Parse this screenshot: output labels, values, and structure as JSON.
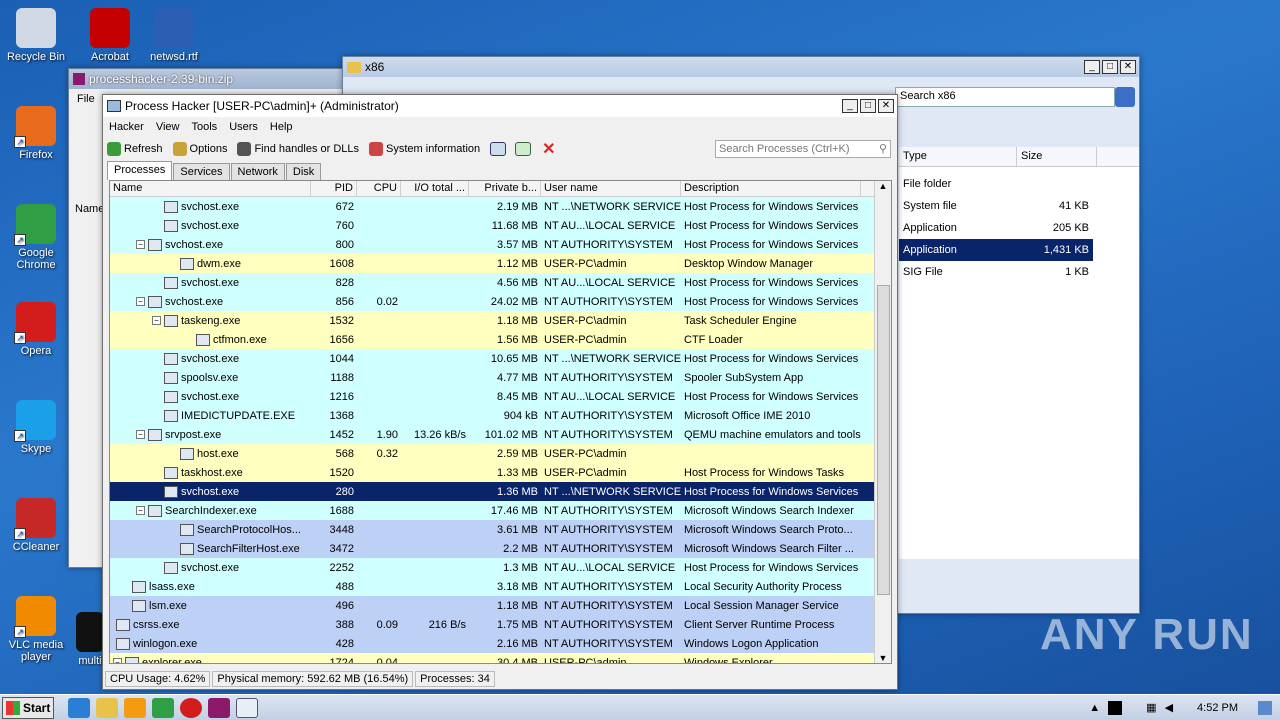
{
  "desktop": {
    "icons": [
      {
        "label": "Recycle Bin",
        "icon": "recycle-bin-icon",
        "color": "#cfd8e3"
      },
      {
        "label": "Firefox",
        "icon": "firefox-icon",
        "color": "#e86a1c"
      },
      {
        "label": "Google Chrome",
        "icon": "chrome-icon",
        "color": "#2f9e44"
      },
      {
        "label": "Opera",
        "icon": "opera-icon",
        "color": "#d31c1c"
      },
      {
        "label": "Skype",
        "icon": "skype-icon",
        "color": "#1aa0e8"
      },
      {
        "label": "CCleaner",
        "icon": "ccleaner-icon",
        "color": "#c62828"
      },
      {
        "label": "VLC media player",
        "icon": "vlc-icon",
        "color": "#f08a00"
      }
    ],
    "col2": [
      {
        "label": "Acrobat",
        "icon": "acrobat-icon",
        "color": "#c40000"
      },
      {
        "label": "netwsd.rtf",
        "icon": "word-doc-icon",
        "color": "#2b5fb4"
      }
    ],
    "multi_label": "multi"
  },
  "explorer": {
    "title": "x86",
    "search_placeholder": "Search x86",
    "col_type": "Type",
    "col_size": "Size",
    "rows": [
      {
        "type": "File folder",
        "size": ""
      },
      {
        "type": "System file",
        "size": "41 KB"
      },
      {
        "type": "Application",
        "size": "205 KB"
      },
      {
        "type": "Application",
        "size": "1,431 KB"
      },
      {
        "type": "SIG File",
        "size": "1 KB"
      }
    ]
  },
  "zipwin": {
    "title": "processhacker-2.39-bin.zip",
    "menu_file": "File",
    "col_name": "Name"
  },
  "ph": {
    "title": "Process Hacker [USER-PC\\admin]+ (Administrator)",
    "menu": [
      "Hacker",
      "View",
      "Tools",
      "Users",
      "Help"
    ],
    "toolbar": {
      "refresh": "Refresh",
      "options": "Options",
      "find": "Find handles or DLLs",
      "sysinfo": "System information"
    },
    "search_placeholder": "Search Processes (Ctrl+K)",
    "tabs": [
      "Processes",
      "Services",
      "Network",
      "Disk"
    ],
    "columns": [
      "Name",
      "PID",
      "CPU",
      "I/O total ...",
      "Private b...",
      "User name",
      "Description"
    ],
    "rows": [
      {
        "indent": 3,
        "tog": "",
        "name": "svchost.exe",
        "pid": "672",
        "cpu": "",
        "io": "",
        "priv": "2.19 MB",
        "user": "NT ...\\NETWORK SERVICE",
        "desc": "Host Process for Windows Services",
        "bg": "cyan"
      },
      {
        "indent": 3,
        "tog": "",
        "name": "svchost.exe",
        "pid": "760",
        "cpu": "",
        "io": "",
        "priv": "11.68 MB",
        "user": "NT AU...\\LOCAL SERVICE",
        "desc": "Host Process for Windows Services",
        "bg": "cyan"
      },
      {
        "indent": 2,
        "tog": "−",
        "name": "svchost.exe",
        "pid": "800",
        "cpu": "",
        "io": "",
        "priv": "3.57 MB",
        "user": "NT AUTHORITY\\SYSTEM",
        "desc": "Host Process for Windows Services",
        "bg": "cyan"
      },
      {
        "indent": 4,
        "tog": "",
        "name": "dwm.exe",
        "pid": "1608",
        "cpu": "",
        "io": "",
        "priv": "1.12 MB",
        "user": "USER-PC\\admin",
        "desc": "Desktop Window Manager",
        "bg": "yellow"
      },
      {
        "indent": 3,
        "tog": "",
        "name": "svchost.exe",
        "pid": "828",
        "cpu": "",
        "io": "",
        "priv": "4.56 MB",
        "user": "NT AU...\\LOCAL SERVICE",
        "desc": "Host Process for Windows Services",
        "bg": "cyan"
      },
      {
        "indent": 2,
        "tog": "−",
        "name": "svchost.exe",
        "pid": "856",
        "cpu": "0.02",
        "io": "",
        "priv": "24.02 MB",
        "user": "NT AUTHORITY\\SYSTEM",
        "desc": "Host Process for Windows Services",
        "bg": "cyan"
      },
      {
        "indent": 3,
        "tog": "−",
        "name": "taskeng.exe",
        "pid": "1532",
        "cpu": "",
        "io": "",
        "priv": "1.18 MB",
        "user": "USER-PC\\admin",
        "desc": "Task Scheduler Engine",
        "bg": "yellow"
      },
      {
        "indent": 5,
        "tog": "",
        "name": "ctfmon.exe",
        "pid": "1656",
        "cpu": "",
        "io": "",
        "priv": "1.56 MB",
        "user": "USER-PC\\admin",
        "desc": "CTF Loader",
        "bg": "yellow"
      },
      {
        "indent": 3,
        "tog": "",
        "name": "svchost.exe",
        "pid": "1044",
        "cpu": "",
        "io": "",
        "priv": "10.65 MB",
        "user": "NT ...\\NETWORK SERVICE",
        "desc": "Host Process for Windows Services",
        "bg": "cyan"
      },
      {
        "indent": 3,
        "tog": "",
        "name": "spoolsv.exe",
        "pid": "1188",
        "cpu": "",
        "io": "",
        "priv": "4.77 MB",
        "user": "NT AUTHORITY\\SYSTEM",
        "desc": "Spooler SubSystem App",
        "bg": "cyan"
      },
      {
        "indent": 3,
        "tog": "",
        "name": "svchost.exe",
        "pid": "1216",
        "cpu": "",
        "io": "",
        "priv": "8.45 MB",
        "user": "NT AU...\\LOCAL SERVICE",
        "desc": "Host Process for Windows Services",
        "bg": "cyan"
      },
      {
        "indent": 3,
        "tog": "",
        "name": "IMEDICTUPDATE.EXE",
        "pid": "1368",
        "cpu": "",
        "io": "",
        "priv": "904 kB",
        "user": "NT AUTHORITY\\SYSTEM",
        "desc": "Microsoft Office IME 2010",
        "bg": "cyan"
      },
      {
        "indent": 2,
        "tog": "−",
        "name": "srvpost.exe",
        "pid": "1452",
        "cpu": "1.90",
        "io": "13.26 kB/s",
        "priv": "101.02 MB",
        "user": "NT AUTHORITY\\SYSTEM",
        "desc": "QEMU machine emulators and tools",
        "bg": "cyan"
      },
      {
        "indent": 4,
        "tog": "",
        "name": "host.exe",
        "pid": "568",
        "cpu": "0.32",
        "io": "",
        "priv": "2.59 MB",
        "user": "USER-PC\\admin",
        "desc": "",
        "bg": "yellow"
      },
      {
        "indent": 3,
        "tog": "",
        "name": "taskhost.exe",
        "pid": "1520",
        "cpu": "",
        "io": "",
        "priv": "1.33 MB",
        "user": "USER-PC\\admin",
        "desc": "Host Process for Windows Tasks",
        "bg": "yellow"
      },
      {
        "indent": 3,
        "tog": "",
        "name": "svchost.exe",
        "pid": "280",
        "cpu": "",
        "io": "",
        "priv": "1.36 MB",
        "user": "NT ...\\NETWORK SERVICE",
        "desc": "Host Process for Windows Services",
        "bg": "sel"
      },
      {
        "indent": 2,
        "tog": "−",
        "name": "SearchIndexer.exe",
        "pid": "1688",
        "cpu": "",
        "io": "",
        "priv": "17.46 MB",
        "user": "NT AUTHORITY\\SYSTEM",
        "desc": "Microsoft Windows Search Indexer",
        "bg": "cyan"
      },
      {
        "indent": 4,
        "tog": "",
        "name": "SearchProtocolHos...",
        "pid": "3448",
        "cpu": "",
        "io": "",
        "priv": "3.61 MB",
        "user": "NT AUTHORITY\\SYSTEM",
        "desc": "Microsoft Windows Search Proto...",
        "bg": "blue"
      },
      {
        "indent": 4,
        "tog": "",
        "name": "SearchFilterHost.exe",
        "pid": "3472",
        "cpu": "",
        "io": "",
        "priv": "2.2 MB",
        "user": "NT AUTHORITY\\SYSTEM",
        "desc": "Microsoft Windows Search Filter ...",
        "bg": "blue"
      },
      {
        "indent": 3,
        "tog": "",
        "name": "svchost.exe",
        "pid": "2252",
        "cpu": "",
        "io": "",
        "priv": "1.3 MB",
        "user": "NT AU...\\LOCAL SERVICE",
        "desc": "Host Process for Windows Services",
        "bg": "cyan"
      },
      {
        "indent": 1,
        "tog": "",
        "name": "lsass.exe",
        "pid": "488",
        "cpu": "",
        "io": "",
        "priv": "3.18 MB",
        "user": "NT AUTHORITY\\SYSTEM",
        "desc": "Local Security Authority Process",
        "bg": "cyan"
      },
      {
        "indent": 1,
        "tog": "",
        "name": "lsm.exe",
        "pid": "496",
        "cpu": "",
        "io": "",
        "priv": "1.18 MB",
        "user": "NT AUTHORITY\\SYSTEM",
        "desc": "Local Session Manager Service",
        "bg": "blue"
      },
      {
        "indent": 0,
        "tog": "",
        "name": "csrss.exe",
        "pid": "388",
        "cpu": "0.09",
        "io": "216 B/s",
        "priv": "1.75 MB",
        "user": "NT AUTHORITY\\SYSTEM",
        "desc": "Client Server Runtime Process",
        "bg": "blue"
      },
      {
        "indent": 0,
        "tog": "",
        "name": "winlogon.exe",
        "pid": "428",
        "cpu": "",
        "io": "",
        "priv": "2.16 MB",
        "user": "NT AUTHORITY\\SYSTEM",
        "desc": "Windows Logon Application",
        "bg": "blue"
      },
      {
        "indent": 0,
        "tog": "−",
        "name": "explorer.exe",
        "pid": "1724",
        "cpu": "0.04",
        "io": "",
        "priv": "30.4 MB",
        "user": "USER-PC\\admin",
        "desc": "Windows Explorer",
        "bg": "yellow"
      }
    ],
    "status": {
      "cpu": "CPU Usage: 4.62%",
      "mem": "Physical memory: 592.62 MB (16.54%)",
      "procs": "Processes: 34"
    }
  },
  "taskbar": {
    "start": "Start",
    "clock": "4:52 PM"
  },
  "watermark": "ANY RUN"
}
